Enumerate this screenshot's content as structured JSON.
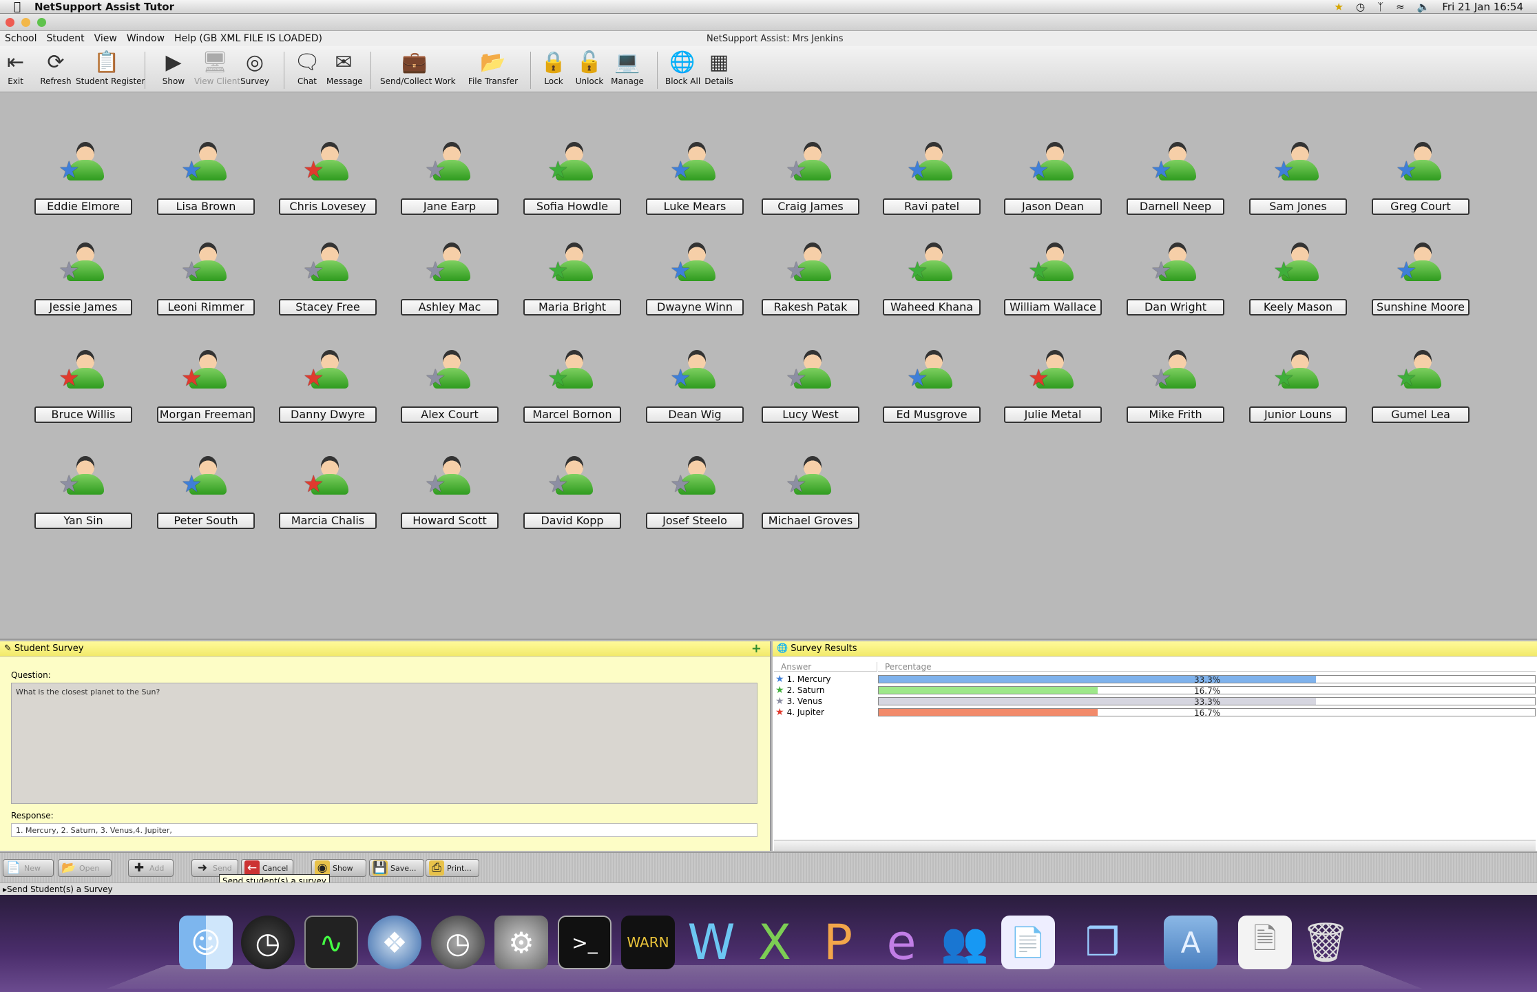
{
  "menubar": {
    "app": "NetSupport Assist Tutor",
    "datetime": "Fri 21 Jan  16:54"
  },
  "appmenu": {
    "items": [
      "School",
      "Student",
      "View",
      "Window",
      "Help (GB XML FILE IS LOADED)"
    ],
    "window_title": "NetSupport Assist: Mrs Jenkins"
  },
  "toolbar": {
    "exit": "Exit",
    "refresh": "Refresh",
    "student_register": "Student Register",
    "show": "Show",
    "view_client": "View Client",
    "survey": "Survey",
    "chat": "Chat",
    "message": "Message",
    "send_collect": "Send/Collect Work",
    "file_transfer": "File Transfer",
    "lock": "Lock",
    "unlock": "Unlock",
    "manage": "Manage",
    "block_all": "Block All",
    "details": "Details"
  },
  "colors": {
    "star_blue": "#3f7fd8",
    "star_green": "#3fae3a",
    "star_gray": "#8d8fa3",
    "star_red": "#e03a2e"
  },
  "students": [
    {
      "name": "Eddie Elmore",
      "star": "blue"
    },
    {
      "name": "Lisa Brown",
      "star": "blue"
    },
    {
      "name": "Chris Lovesey",
      "star": "red"
    },
    {
      "name": "Jane Earp",
      "star": "gray"
    },
    {
      "name": "Sofia Howdle",
      "star": "green"
    },
    {
      "name": "Luke Mears",
      "star": "blue"
    },
    {
      "name": "Craig James",
      "star": "gray"
    },
    {
      "name": "Ravi patel",
      "star": "blue"
    },
    {
      "name": "Jason Dean",
      "star": "blue"
    },
    {
      "name": "Darnell Neep",
      "star": "blue"
    },
    {
      "name": "Sam Jones",
      "star": "blue"
    },
    {
      "name": "Greg Court",
      "star": "blue"
    },
    {
      "name": "Jessie James",
      "star": "gray"
    },
    {
      "name": "Leoni Rimmer",
      "star": "gray"
    },
    {
      "name": "Stacey Free",
      "star": "gray"
    },
    {
      "name": "Ashley Mac",
      "star": "gray"
    },
    {
      "name": "Maria Bright",
      "star": "green"
    },
    {
      "name": "Dwayne Winn",
      "star": "blue"
    },
    {
      "name": "Rakesh Patak",
      "star": "gray"
    },
    {
      "name": "Waheed Khana",
      "star": "green"
    },
    {
      "name": "William Wallace",
      "star": "green"
    },
    {
      "name": "Dan Wright",
      "star": "gray"
    },
    {
      "name": "Keely Mason",
      "star": "green"
    },
    {
      "name": "Sunshine Moore",
      "star": "blue"
    },
    {
      "name": "Bruce Willis",
      "star": "red"
    },
    {
      "name": "Morgan Freeman",
      "star": "red"
    },
    {
      "name": "Danny Dwyre",
      "star": "red"
    },
    {
      "name": "Alex Court",
      "star": "gray"
    },
    {
      "name": "Marcel Bornon",
      "star": "green"
    },
    {
      "name": "Dean Wig",
      "star": "blue"
    },
    {
      "name": "Lucy West",
      "star": "gray"
    },
    {
      "name": "Ed Musgrove",
      "star": "blue"
    },
    {
      "name": "Julie Metal",
      "star": "red"
    },
    {
      "name": "Mike Frith",
      "star": "gray"
    },
    {
      "name": "Junior Louns",
      "star": "green"
    },
    {
      "name": "Gumel Lea",
      "star": "green"
    },
    {
      "name": "Yan Sin",
      "star": "gray"
    },
    {
      "name": "Peter South",
      "star": "blue"
    },
    {
      "name": "Marcia Chalis",
      "star": "red"
    },
    {
      "name": "Howard Scott",
      "star": "gray"
    },
    {
      "name": "David Kopp",
      "star": "gray"
    },
    {
      "name": "Josef Steelo",
      "star": "gray"
    },
    {
      "name": "Michael Groves",
      "star": "gray"
    }
  ],
  "survey": {
    "title": "Student Survey",
    "question_label": "Question:",
    "question": "What is the closest planet to the Sun?",
    "response_label": "Response:",
    "response": "1. Mercury, 2. Saturn, 3. Venus,4. Jupiter,"
  },
  "results": {
    "title": "Survey Results",
    "col_answer": "Answer",
    "col_percentage": "Percentage",
    "rows": [
      {
        "answer": "1. Mercury",
        "pct": "33.3%",
        "value": 33.3,
        "star": "blue",
        "bar": "#7fb2ec"
      },
      {
        "answer": "2. Saturn",
        "pct": "16.7%",
        "value": 16.7,
        "star": "green",
        "bar": "#9ee88a"
      },
      {
        "answer": "3. Venus",
        "pct": "33.3%",
        "value": 33.3,
        "star": "gray",
        "bar": "#d6d6e0"
      },
      {
        "answer": "4. Jupiter",
        "pct": "16.7%",
        "value": 16.7,
        "star": "red",
        "bar": "#f28a6a"
      }
    ]
  },
  "bottombar": {
    "new": "New",
    "open": "Open",
    "add": "Add",
    "send": "Send",
    "cancel": "Cancel",
    "show": "Show",
    "save": "Save...",
    "print": "Print..."
  },
  "tooltip": "Send student(s) a survey",
  "status": "Send Student(s) a Survey"
}
